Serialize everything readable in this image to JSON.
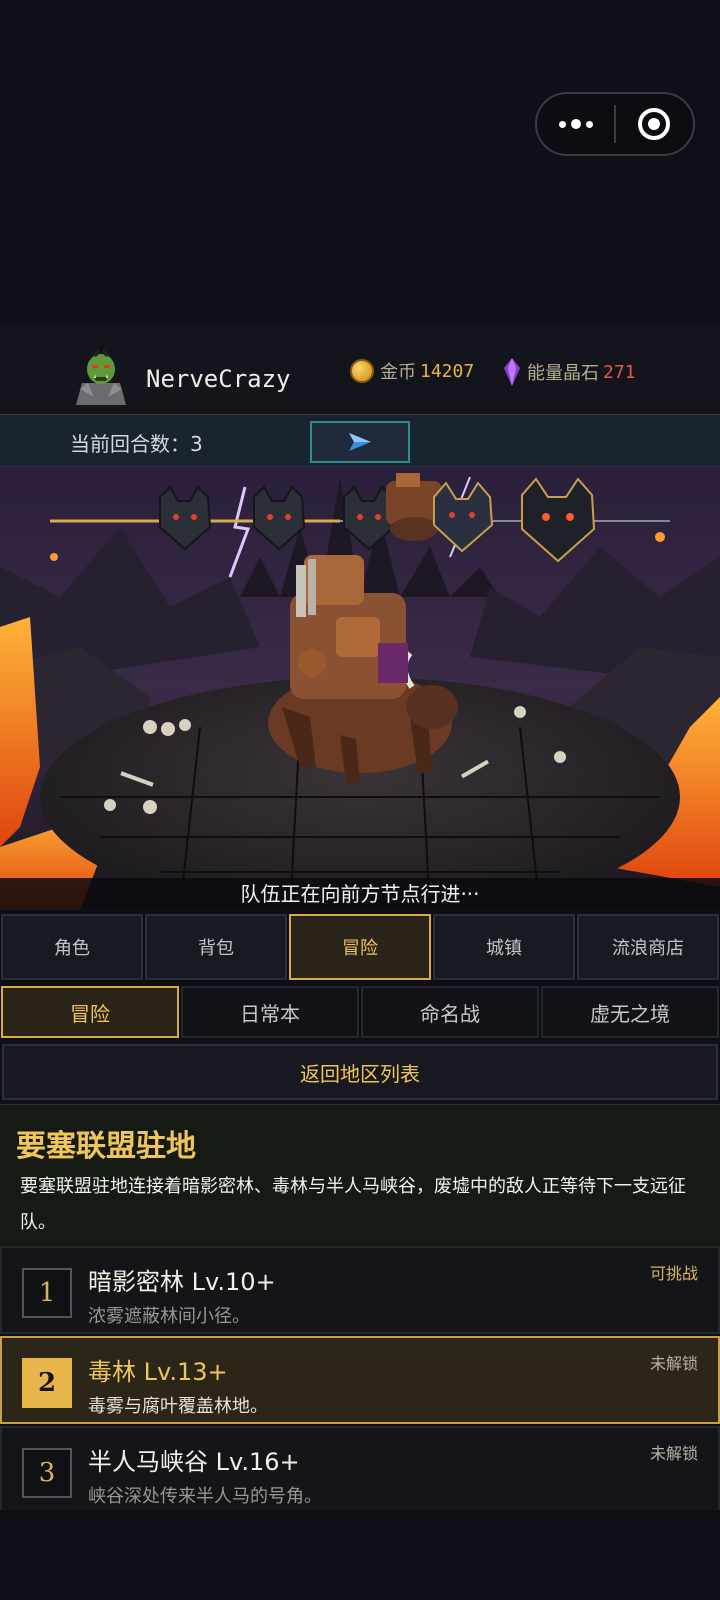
{
  "header": {
    "username": "NerveCrazy",
    "gold_label": "金币",
    "gold_value": "14207",
    "crystal_label": "能量晶石",
    "crystal_value": "271"
  },
  "round": {
    "label": "当前回合数：3"
  },
  "scene": {
    "caption": "队伍正在向前方节点行进···"
  },
  "main_tabs": [
    "角色",
    "背包",
    "冒险",
    "城镇",
    "流浪商店"
  ],
  "sub_tabs": [
    "冒险",
    "日常本",
    "命名战",
    "虚无之境"
  ],
  "back_button": "返回地区列表",
  "region": {
    "title": "要塞联盟驻地",
    "description": "要塞联盟驻地连接着暗影密林、毒林与半人马峡谷，废墟中的敌人正等待下一支远征队。"
  },
  "stages": [
    {
      "num": "1",
      "title": "暗影密林 Lv.10+",
      "desc": "浓雾遮蔽林间小径。",
      "status": "可挑战"
    },
    {
      "num": "2",
      "title": "毒林 Lv.13+",
      "desc": "毒雾与腐叶覆盖林地。",
      "status": "未解锁"
    },
    {
      "num": "3",
      "title": "半人马峡谷 Lv.16+",
      "desc": "峡谷深处传来半人马的号角。",
      "status": "未解锁"
    }
  ],
  "colors": {
    "accent": "#d8ab48",
    "gold": "#e2b545",
    "crystal": "#e05a4a",
    "teal": "#2f8d87"
  }
}
